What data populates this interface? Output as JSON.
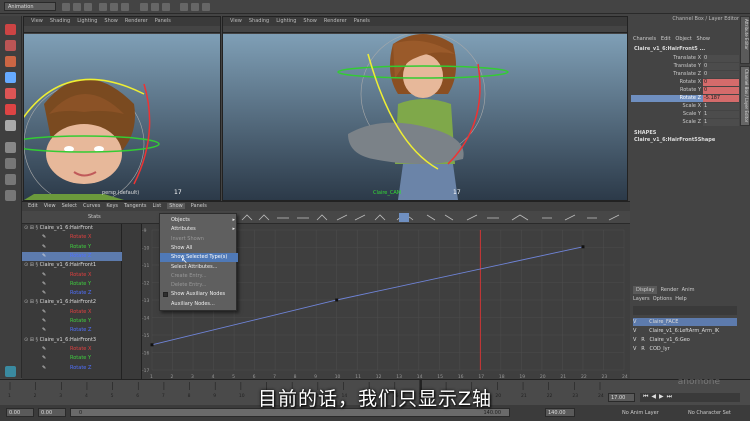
{
  "topbar": {
    "mode": "Animation"
  },
  "viewport_left": {
    "menu": [
      "View",
      "Shading",
      "Lighting",
      "Show",
      "Renderer",
      "Panels"
    ],
    "cam_label": "persp (default)",
    "frame": "17"
  },
  "viewport_right": {
    "menu": [
      "View",
      "Shading",
      "Lighting",
      "Show",
      "Renderer",
      "Panels"
    ],
    "cam_label": "Claire_CAM",
    "frame": "17"
  },
  "channel_box": {
    "header": "Channel Box / Layer Editor",
    "menu": [
      "Channels",
      "Edit",
      "Object",
      "Show"
    ],
    "object": "Claire_v1_6:HairFront5 ...",
    "channels": [
      {
        "label": "Translate X",
        "value": "0"
      },
      {
        "label": "Translate Y",
        "value": "0"
      },
      {
        "label": "Translate Z",
        "value": "0"
      },
      {
        "label": "Rotate X",
        "value": "0"
      },
      {
        "label": "Rotate Y",
        "value": "0"
      },
      {
        "label": "Rotate Z",
        "value": "-5.187"
      },
      {
        "label": "Scale X",
        "value": "1"
      },
      {
        "label": "Scale Y",
        "value": "1"
      },
      {
        "label": "Scale Z",
        "value": "1"
      }
    ],
    "shapes_title": "SHAPES",
    "shape_name": "Claire_v1_6:HairFront5Shape"
  },
  "side_tabs": [
    "Attribute Editor",
    "Channel Box / Layer Editor"
  ],
  "layer_editor": {
    "tabs": [
      "Display",
      "Render",
      "Anim"
    ],
    "menu": [
      "Layers",
      "Options",
      "Help"
    ],
    "layers": [
      {
        "v": "V",
        "r": "",
        "name": "Claire_FACE"
      },
      {
        "v": "V",
        "r": "",
        "name": "Claire_v1_6:LeftArm_Arm_IK"
      },
      {
        "v": "V",
        "r": "R",
        "name": "Claire_v1_6:Geo"
      },
      {
        "v": "V",
        "r": "R",
        "name": "COD_lyr"
      }
    ]
  },
  "graph_editor": {
    "menu": [
      "Edit",
      "View",
      "Select",
      "Curves",
      "Keys",
      "Tangents",
      "List",
      "Show",
      "Panels"
    ],
    "stats_label": "Stats",
    "outliner": [
      {
        "type": "node",
        "text": "Claire_v1_6:HairFront"
      },
      {
        "type": "attr",
        "text": "Rotate X",
        "color": "#e04040"
      },
      {
        "type": "attr",
        "text": "Rotate Y",
        "color": "#40d040"
      },
      {
        "type": "attr",
        "text": "Rotate Z",
        "color": "#5070ff",
        "hl": true
      },
      {
        "type": "node",
        "text": "Claire_v1_6:HairFront1"
      },
      {
        "type": "attr",
        "text": "Rotate X",
        "color": "#e04040"
      },
      {
        "type": "attr",
        "text": "Rotate Y",
        "color": "#40d040"
      },
      {
        "type": "attr",
        "text": "Rotate Z",
        "color": "#5070ff"
      },
      {
        "type": "node",
        "text": "Claire_v1_6:HairFront2"
      },
      {
        "type": "attr",
        "text": "Rotate X",
        "color": "#e04040"
      },
      {
        "type": "attr",
        "text": "Rotate Y",
        "color": "#40d040"
      },
      {
        "type": "attr",
        "text": "Rotate Z",
        "color": "#5070ff"
      },
      {
        "type": "node",
        "text": "Claire_v1_6:HairFront3"
      },
      {
        "type": "attr",
        "text": "Rotate X",
        "color": "#e04040"
      },
      {
        "type": "attr",
        "text": "Rotate Y",
        "color": "#40d040"
      },
      {
        "type": "attr",
        "text": "Rotate Z",
        "color": "#5070ff"
      }
    ],
    "y_ticks": [
      "-9",
      "-10",
      "-11",
      "-12",
      "-13",
      "-14",
      "-15",
      "-16",
      "-17"
    ],
    "x_ticks": [
      "1",
      "2",
      "3",
      "4",
      "5",
      "6",
      "7",
      "8",
      "9",
      "10",
      "11",
      "12",
      "13",
      "14",
      "15",
      "16",
      "17",
      "18",
      "19",
      "20",
      "21",
      "22",
      "23",
      "24"
    ],
    "current_frame": "17"
  },
  "show_menu": {
    "items": [
      {
        "label": "Objects",
        "state": "normal",
        "arrow": true
      },
      {
        "label": "Attributes",
        "state": "normal",
        "arrow": true
      },
      {
        "label": "Invert Shown",
        "state": "disabled"
      },
      {
        "label": "Show All",
        "state": "normal"
      },
      {
        "label": "Show Selected Type(s)",
        "state": "highlight"
      },
      {
        "label": "Select Attributes...",
        "state": "normal"
      },
      {
        "label": "Create Entry...",
        "state": "disabled"
      },
      {
        "label": "Delete Entry...",
        "state": "disabled"
      },
      {
        "label": "Show Auxiliary Nodes",
        "state": "normal",
        "checkbox": true
      },
      {
        "label": "Auxiliary Nodes...",
        "state": "normal"
      }
    ]
  },
  "timeline": {
    "current": "17",
    "ticks": [
      "1",
      "2",
      "3",
      "4",
      "5",
      "6",
      "7",
      "8",
      "9",
      "10",
      "11",
      "12",
      "13",
      "14",
      "15",
      "16",
      "17",
      "18",
      "19",
      "20",
      "21",
      "22",
      "23",
      "24"
    ],
    "end_field": "17.00"
  },
  "range": {
    "start": "0.00",
    "inner_start": "0.00",
    "mid_value": "0",
    "inner_end": "140.00",
    "end": "140.00",
    "anim_layer": "No Anim Layer",
    "char_set": "No Character Set"
  },
  "subtitle": "目前的话，我们只显示Z轴",
  "watermark": "anomone"
}
